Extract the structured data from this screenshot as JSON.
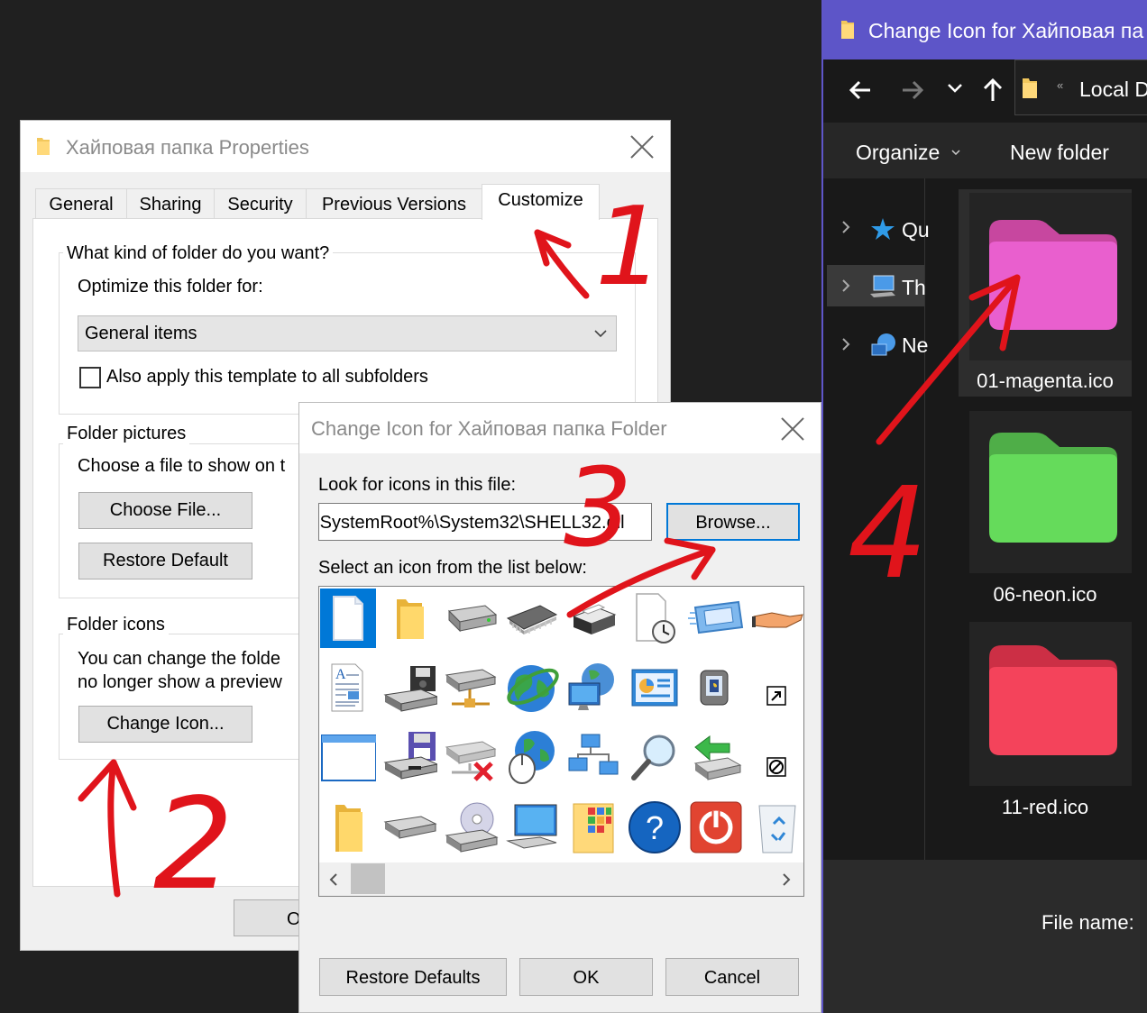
{
  "properties": {
    "title": "Хайповая папка Properties",
    "tabs": [
      "General",
      "Sharing",
      "Security",
      "Previous Versions",
      "Customize"
    ],
    "active_tab": "Customize",
    "group1_label": "What kind of folder do you want?",
    "optimize_label": "Optimize this folder for:",
    "optimize_value": "General items",
    "apply_template_label": "Also apply this template to all subfolders",
    "group2_label": "Folder pictures",
    "choose_file_text": "Choose a file to show on t",
    "choose_file_button": "Choose File...",
    "restore_default_button": "Restore Default",
    "group3_label": "Folder icons",
    "folder_icons_text1": "You can change the folde",
    "folder_icons_text2": "no longer show a preview",
    "change_icon_button": "Change Icon...",
    "ok_button_partial": "O"
  },
  "change_icon": {
    "title": "Change Icon for Хайповая папка Folder",
    "look_for_label": "Look for icons in this file:",
    "file_path": "›SystemRoot%\\System32\\SHELL32.dll",
    "browse_button": "Browse...",
    "select_label": "Select an icon from the list below:",
    "icons": [
      [
        "blank-document-icon",
        "folder-icon",
        "hard-drive-icon",
        "memory-chip-icon",
        "printer-icon",
        "scheduled-document-icon",
        "display-window-icon",
        "sharing-hand-icon"
      ],
      [
        "text-document-icon",
        "floppy-drive-icon",
        "network-drive-icon",
        "globe-icon",
        "network-globe-icon",
        "control-panel-icon",
        "phone-icon",
        "shortcut-arrow-icon"
      ],
      [
        "application-window-icon",
        "floppy-save-icon",
        "disconnected-drive-icon",
        "mouse-globe-icon",
        "network-computers-icon",
        "search-icon",
        "green-arrow-drive-icon",
        "blocked-icon"
      ],
      [
        "folder-icon",
        "disk-drive-icon",
        "cd-drive-icon",
        "monitor-icon",
        "image-folder-icon",
        "help-icon",
        "power-icon",
        "recycle-bin-icon"
      ]
    ],
    "restore_defaults_button": "Restore Defaults",
    "ok_button": "OK",
    "cancel_button": "Cancel"
  },
  "explorer": {
    "title": "Change Icon for Хайповая па",
    "address": "Local D",
    "organize_label": "Organize",
    "new_folder_label": "New folder",
    "nav_items": [
      "Qu",
      "Th",
      "Ne"
    ],
    "files": [
      {
        "name": "01-magenta.ico",
        "color": "#e95fce",
        "tab_color": "#c7479f"
      },
      {
        "name": "06-neon.ico",
        "color": "#65db5b",
        "tab_color": "#4fae48"
      },
      {
        "name": "11-red.ico",
        "color": "#f4435b",
        "tab_color": "#cc2f45"
      }
    ],
    "file_name_label": "File name:"
  },
  "annotations": [
    "1",
    "2",
    "3",
    "4"
  ]
}
